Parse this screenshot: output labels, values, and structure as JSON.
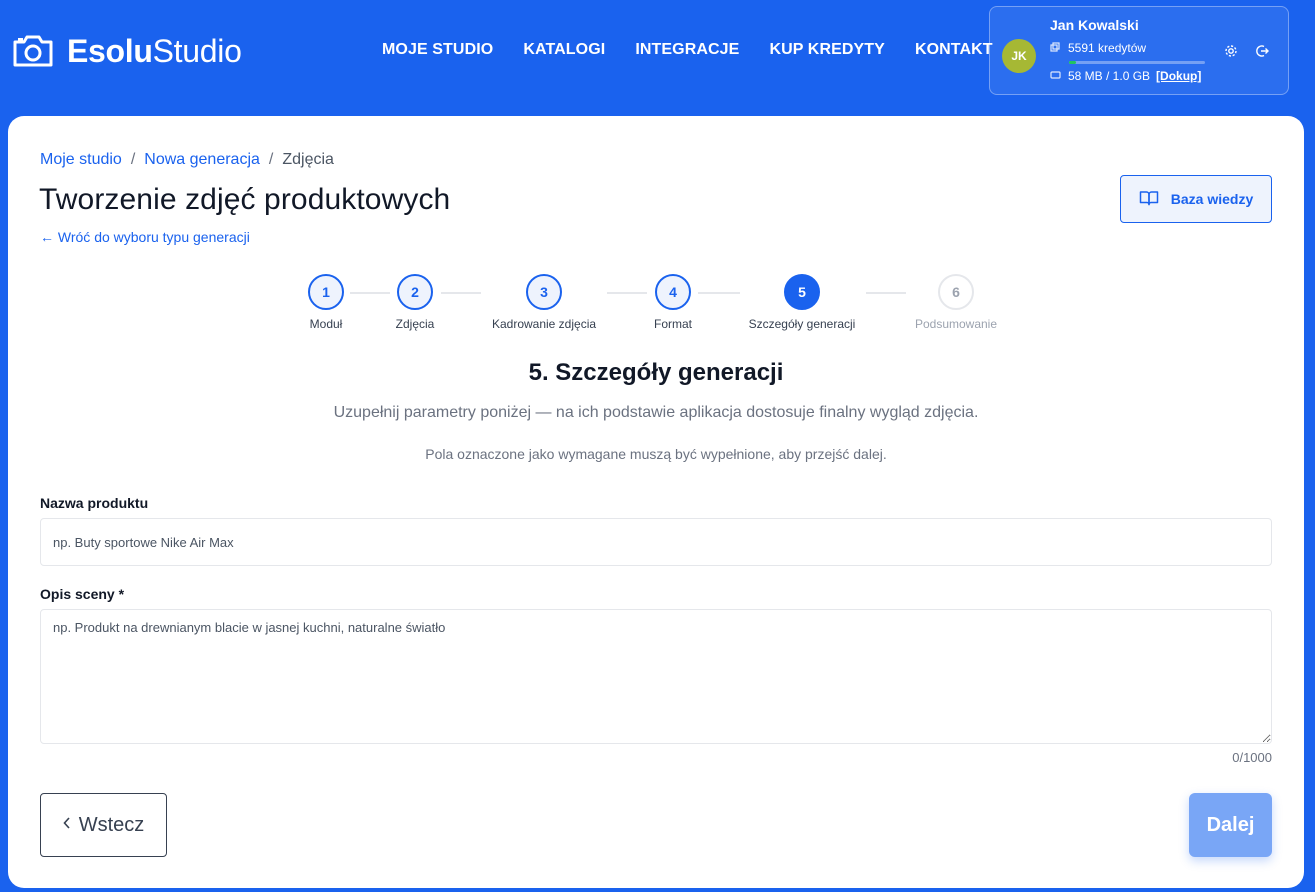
{
  "brand": {
    "bold": "Esolu",
    "light": "Studio"
  },
  "nav": [
    {
      "label": "MOJE STUDIO"
    },
    {
      "label": "KATALOGI"
    },
    {
      "label": "INTEGRACJE"
    },
    {
      "label": "KUP KREDYTY"
    },
    {
      "label": "KONTAKT"
    }
  ],
  "user": {
    "name": "Jan Kowalski",
    "initials": "JK",
    "avatar_color": "#a6b834",
    "credits": "5591 kredytów",
    "credits_fill": 0.05,
    "storage": "58 MB / 1.0 GB",
    "storage_action": "[Dokup]"
  },
  "breadcrumb": {
    "item1": "Moje studio",
    "item2": "Nowa generacja",
    "current": "Zdjęcia",
    "sep": "/"
  },
  "page": {
    "title": "Tworzenie zdjęć produktowych",
    "back_link": "← Wróć do wyboru typu generacji",
    "knowledge_button": "Baza wiedzy"
  },
  "steps": [
    {
      "num": "1",
      "label": "Moduł",
      "state": "done"
    },
    {
      "num": "2",
      "label": "Zdjęcia",
      "state": "done"
    },
    {
      "num": "3",
      "label": "Kadrowanie zdjęcia",
      "state": "done"
    },
    {
      "num": "4",
      "label": "Format",
      "state": "done"
    },
    {
      "num": "5",
      "label": "Szczegóły generacji",
      "state": "active"
    },
    {
      "num": "6",
      "label": "Podsumowanie",
      "state": "todo"
    }
  ],
  "section": {
    "heading": "5. Szczegóły generacji",
    "subtitle": "Uzupełnij parametry poniżej — na ich podstawie aplikacja dostosuje finalny wygląd zdjęcia.",
    "note": "Pola oznaczone jako wymagane muszą być wypełnione, aby przejść dalej."
  },
  "form": {
    "product_label": "Nazwa produktu",
    "product_placeholder": "np. Buty sportowe Nike Air Max",
    "product_value": "",
    "scene_label": "Opis sceny *",
    "scene_placeholder": "np. Produkt na drewnianym blacie w jasnej kuchni, naturalne światło",
    "scene_value": "",
    "counter": "0/1000"
  },
  "actions": {
    "back": "Wstecz",
    "next": "Dalej"
  },
  "colors": {
    "primary": "#1a62ee",
    "next_disabled": "#79a6f6",
    "credit_bar": "#22c55e"
  }
}
